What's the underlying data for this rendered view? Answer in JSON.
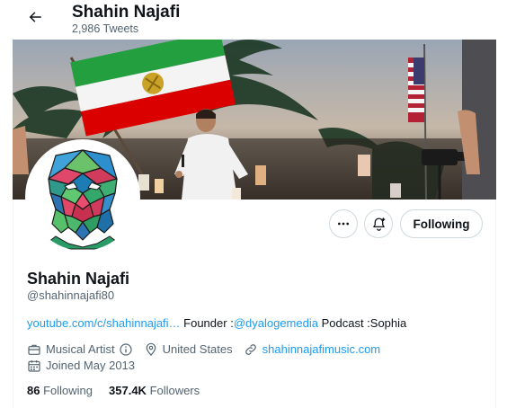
{
  "header": {
    "title": "Shahin Najafi",
    "tweet_count": "2,986 Tweets"
  },
  "profile": {
    "name": "Shahin Najafi",
    "handle": "@shahinnajafi80",
    "bio": {
      "link": "youtube.com/c/shahinnajafi…",
      "text1": " Founder :",
      "mention": "@dyalogemedia",
      "text2": " Podcast :Sophia"
    },
    "category": "Musical Artist",
    "location": "United States",
    "website": "shahinnajafimusic.com",
    "joined": "Joined May 2013",
    "following_count": "86",
    "following_label": "Following",
    "followers_count": "357.4K",
    "followers_label": "Followers"
  },
  "actions": {
    "follow_button": "Following"
  },
  "icons": {
    "back": "back-arrow-icon",
    "more": "more-icon",
    "notify": "notification-bell-icon",
    "category": "briefcase-icon",
    "info": "info-icon",
    "location": "location-pin-icon",
    "website": "link-icon",
    "joined": "calendar-icon"
  },
  "colors": {
    "accent": "#1d9bf0",
    "secondary_text": "#536471",
    "primary_text": "#0f1419",
    "border": "#cfd9de"
  }
}
